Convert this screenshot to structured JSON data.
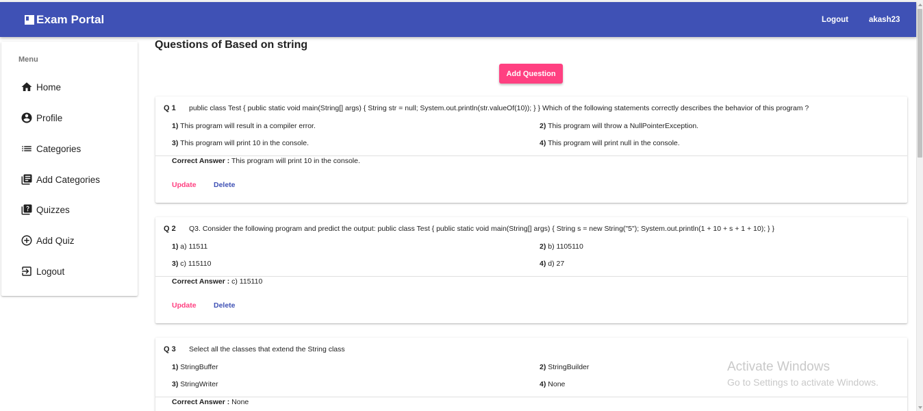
{
  "navbar": {
    "brand": "Exam Portal",
    "logout": "Logout",
    "username": "akash23",
    "color": "#3f51b5"
  },
  "sidebar": {
    "menu_title": "Menu",
    "items": [
      {
        "label": "Home",
        "icon": "home-icon"
      },
      {
        "label": "Profile",
        "icon": "account-circle-icon"
      },
      {
        "label": "Categories",
        "icon": "list-icon"
      },
      {
        "label": "Add Categories",
        "icon": "library-books-icon"
      },
      {
        "label": "Quizzes",
        "icon": "quiz-icon"
      },
      {
        "label": "Add Quiz",
        "icon": "add-circle-icon"
      },
      {
        "label": "Logout",
        "icon": "logout-icon"
      }
    ]
  },
  "main": {
    "title": "Questions of Based on string",
    "add_button": "Add Question",
    "accent": "#ff4081",
    "correct_answer_label": "Correct Answer :",
    "update_label": "Update",
    "delete_label": "Delete",
    "questions": [
      {
        "number": "Q 1",
        "text": "public class Test { public static void main(String[] args) { String str = null; System.out.println(str.valueOf(10)); } } Which of the following statements correctly describes the behavior of this program ?",
        "options": [
          {
            "num": "1)",
            "text": "This program will result in a compiler error."
          },
          {
            "num": "2)",
            "text": "This program will throw a NullPointerException."
          },
          {
            "num": "3)",
            "text": "This program will print 10 in the console."
          },
          {
            "num": "4)",
            "text": "This program will print null in the console."
          }
        ],
        "answer": "This program will print 10 in the console."
      },
      {
        "number": "Q 2",
        "text": "Q3. Consider the following program and predict the output: public class Test { public static void main(String[] args) { String s = new String(\"5\"); System.out.println(1 + 10 + s + 1 + 10); } }",
        "options": [
          {
            "num": "1)",
            "text": "a) 11511"
          },
          {
            "num": "2)",
            "text": "b) 1105110"
          },
          {
            "num": "3)",
            "text": "c) 115110"
          },
          {
            "num": "4)",
            "text": "d) 27"
          }
        ],
        "answer": "c) 115110"
      },
      {
        "number": "Q 3",
        "text": "Select all the classes that extend the String class",
        "options": [
          {
            "num": "1)",
            "text": "StringBuffer"
          },
          {
            "num": "2)",
            "text": "StringBuilder"
          },
          {
            "num": "3)",
            "text": "StringWriter"
          },
          {
            "num": "4)",
            "text": "None"
          }
        ],
        "answer": "None"
      }
    ]
  },
  "watermark": {
    "line1": "Activate Windows",
    "line2": "Go to Settings to activate Windows."
  }
}
